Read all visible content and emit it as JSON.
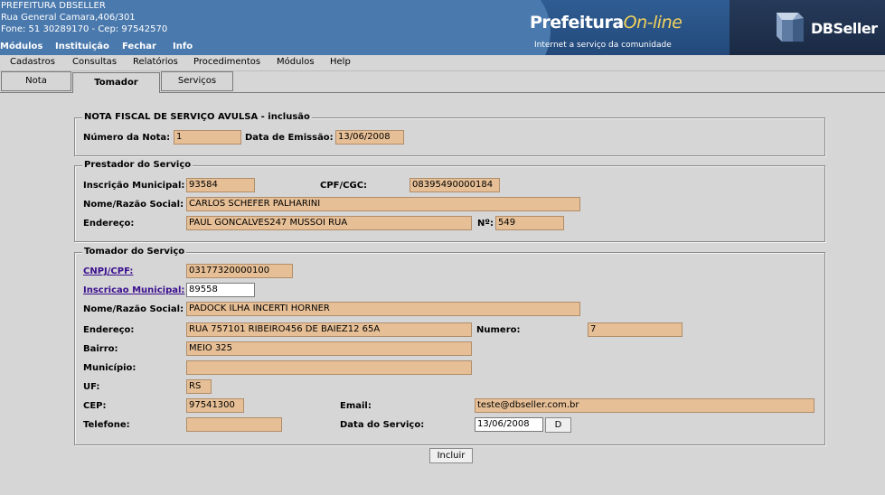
{
  "header": {
    "org_name": "PREFEITURA DBSELLER",
    "address": "Rua General Camara,406/301",
    "contact": "Fone: 51 30289170  -  Cep: 97542570",
    "top_menu": [
      "Módulos",
      "Instituição",
      "Fechar",
      "Info"
    ],
    "banner": {
      "brand_a": "Prefeitura",
      "brand_b": "On-line",
      "tagline": "Internet a serviço da comunidade",
      "company": "DBSeller"
    }
  },
  "menubar": [
    "Cadastros",
    "Consultas",
    "Relatórios",
    "Procedimentos",
    "Módulos",
    "Help"
  ],
  "tabs": [
    {
      "label": "Nota"
    },
    {
      "label": "Tomador"
    },
    {
      "label": "Serviços"
    }
  ],
  "nota": {
    "legend": "NOTA FISCAL DE SERVIÇO AVULSA - inclusão",
    "numero_label": "Número da Nota:",
    "numero_value": "1",
    "emissao_label": "Data de Emissão:",
    "emissao_value": "13/06/2008"
  },
  "prestador": {
    "legend": "Prestador do Serviço",
    "inscricao_label": "Inscrição Municipal:",
    "inscricao_value": "93584",
    "cpf_label": "CPF/CGC:",
    "cpf_value": "08395490000184",
    "nome_label": "Nome/Razão Social:",
    "nome_value": "CARLOS SCHEFER PALHARINI",
    "endereco_label": "Endereço:",
    "endereco_value": "PAUL GONCALVES247 MUSSOI RUA",
    "numero_label": "Nº:",
    "numero_value": "549"
  },
  "tomador": {
    "legend": "Tomador do Serviço",
    "cnpj_label": "CNPJ/CPF:",
    "cnpj_value": "03177320000100",
    "inscricao_label": "Inscricao Municipal:",
    "inscricao_value": "89558",
    "nome_label": "Nome/Razão Social:",
    "nome_value": "PADOCK ILHA INCERTI HORNER",
    "endereco_label": "Endereço:",
    "endereco_value": "RUA 757101 RIBEIRO456 DE BAIEZ12 65A",
    "numero_label": "Numero:",
    "numero_value": "7",
    "bairro_label": "Bairro:",
    "bairro_value": "MEIO 325",
    "municipio_label": "Município:",
    "municipio_value": "",
    "uf_label": "UF:",
    "uf_value": "RS",
    "cep_label": "CEP:",
    "cep_value": "97541300",
    "email_label": "Email:",
    "email_value": "teste@dbseller.com.br",
    "telefone_label": "Telefone:",
    "telefone_value": "",
    "data_servico_label": "Data do Serviço:",
    "data_servico_value": "13/06/2008",
    "date_button": "D"
  },
  "actions": {
    "incluir": "Incluir"
  },
  "colors": {
    "header_blue": "#4a79ad",
    "field_fill": "#e6bf96",
    "background": "#d6d6d6",
    "link": "#3b0f8f"
  }
}
